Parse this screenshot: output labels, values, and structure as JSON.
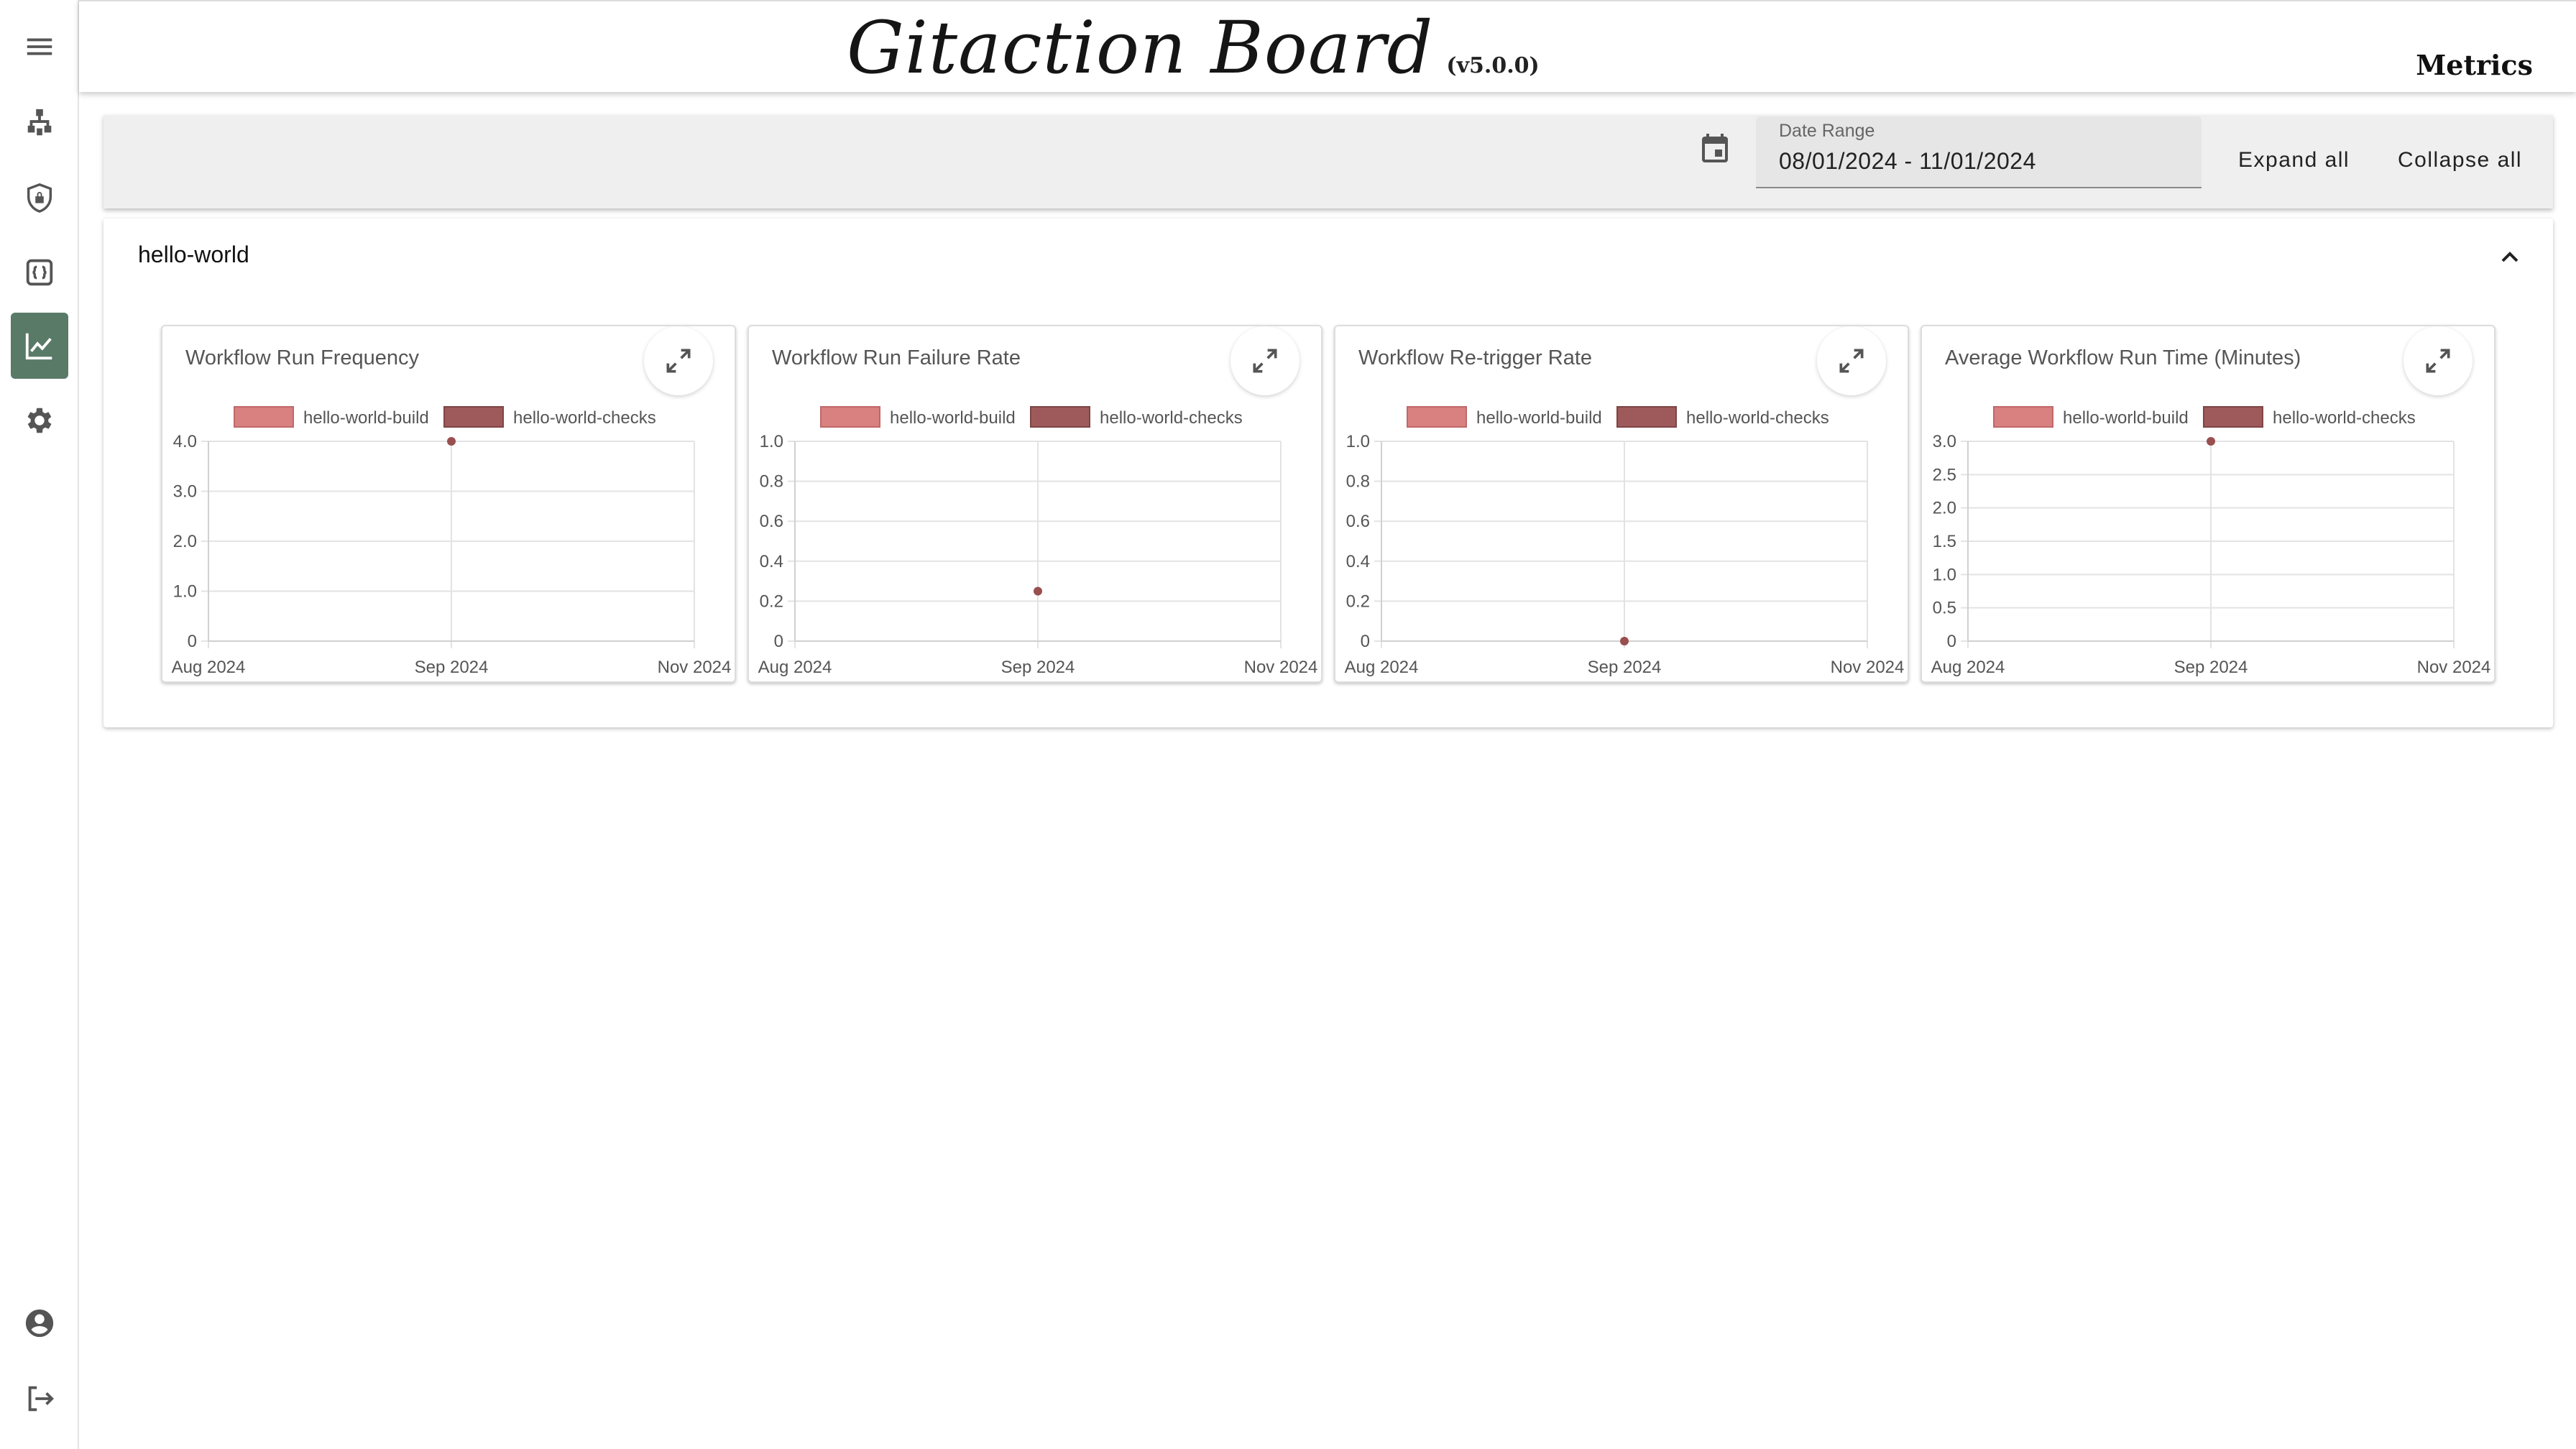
{
  "app": {
    "title": "Gitaction Board",
    "version": "(v5.0.0)",
    "page_name": "Metrics"
  },
  "sidebar": {
    "items": [
      {
        "icon": "menu-icon"
      },
      {
        "icon": "sitemap-icon"
      },
      {
        "icon": "shield-lock-icon"
      },
      {
        "icon": "code-braces-icon"
      },
      {
        "icon": "chart-line-icon",
        "active": true
      },
      {
        "icon": "gear-icon"
      },
      {
        "icon": "account-circle-icon"
      },
      {
        "icon": "logout-icon"
      }
    ]
  },
  "toolbar": {
    "date_label": "Date Range",
    "date_value": "08/01/2024 - 11/01/2024",
    "expand_label": "Expand all",
    "collapse_label": "Collapse all"
  },
  "repo": {
    "name": "hello-world"
  },
  "colors": {
    "series_build": "#d98080",
    "series_checks": "#9e5a5a",
    "point": "#9a4f4f",
    "active_nav": "#5a7a68"
  },
  "chart_data": [
    {
      "type": "line",
      "title": "Workflow Run Frequency",
      "x": [
        "Aug 2024",
        "Sep 2024",
        "Nov 2024"
      ],
      "ylim": [
        0,
        4
      ],
      "yticks": [
        "0",
        "1.0",
        "2.0",
        "3.0",
        "4.0"
      ],
      "series": [
        {
          "name": "hello-world-build",
          "values": []
        },
        {
          "name": "hello-world-checks",
          "values": [
            {
              "x": "Sep 2024",
              "y": 4
            }
          ]
        }
      ]
    },
    {
      "type": "line",
      "title": "Workflow Run Failure Rate",
      "x": [
        "Aug 2024",
        "Sep 2024",
        "Nov 2024"
      ],
      "ylim": [
        0,
        1
      ],
      "yticks": [
        "0",
        "0.2",
        "0.4",
        "0.6",
        "0.8",
        "1.0"
      ],
      "series": [
        {
          "name": "hello-world-build",
          "values": []
        },
        {
          "name": "hello-world-checks",
          "values": [
            {
              "x": "Sep 2024",
              "y": 0.25
            }
          ]
        }
      ]
    },
    {
      "type": "line",
      "title": "Workflow Re-trigger Rate",
      "x": [
        "Aug 2024",
        "Sep 2024",
        "Nov 2024"
      ],
      "ylim": [
        0,
        1
      ],
      "yticks": [
        "0",
        "0.2",
        "0.4",
        "0.6",
        "0.8",
        "1.0"
      ],
      "series": [
        {
          "name": "hello-world-build",
          "values": []
        },
        {
          "name": "hello-world-checks",
          "values": [
            {
              "x": "Sep 2024",
              "y": 0
            }
          ]
        }
      ]
    },
    {
      "type": "line",
      "title": "Average Workflow Run Time (Minutes)",
      "x": [
        "Aug 2024",
        "Sep 2024",
        "Nov 2024"
      ],
      "ylim": [
        0,
        3
      ],
      "yticks": [
        "0",
        "0.5",
        "1.0",
        "1.5",
        "2.0",
        "2.5",
        "3.0"
      ],
      "series": [
        {
          "name": "hello-world-build",
          "values": []
        },
        {
          "name": "hello-world-checks",
          "values": [
            {
              "x": "Sep 2024",
              "y": 3
            }
          ]
        }
      ]
    }
  ]
}
